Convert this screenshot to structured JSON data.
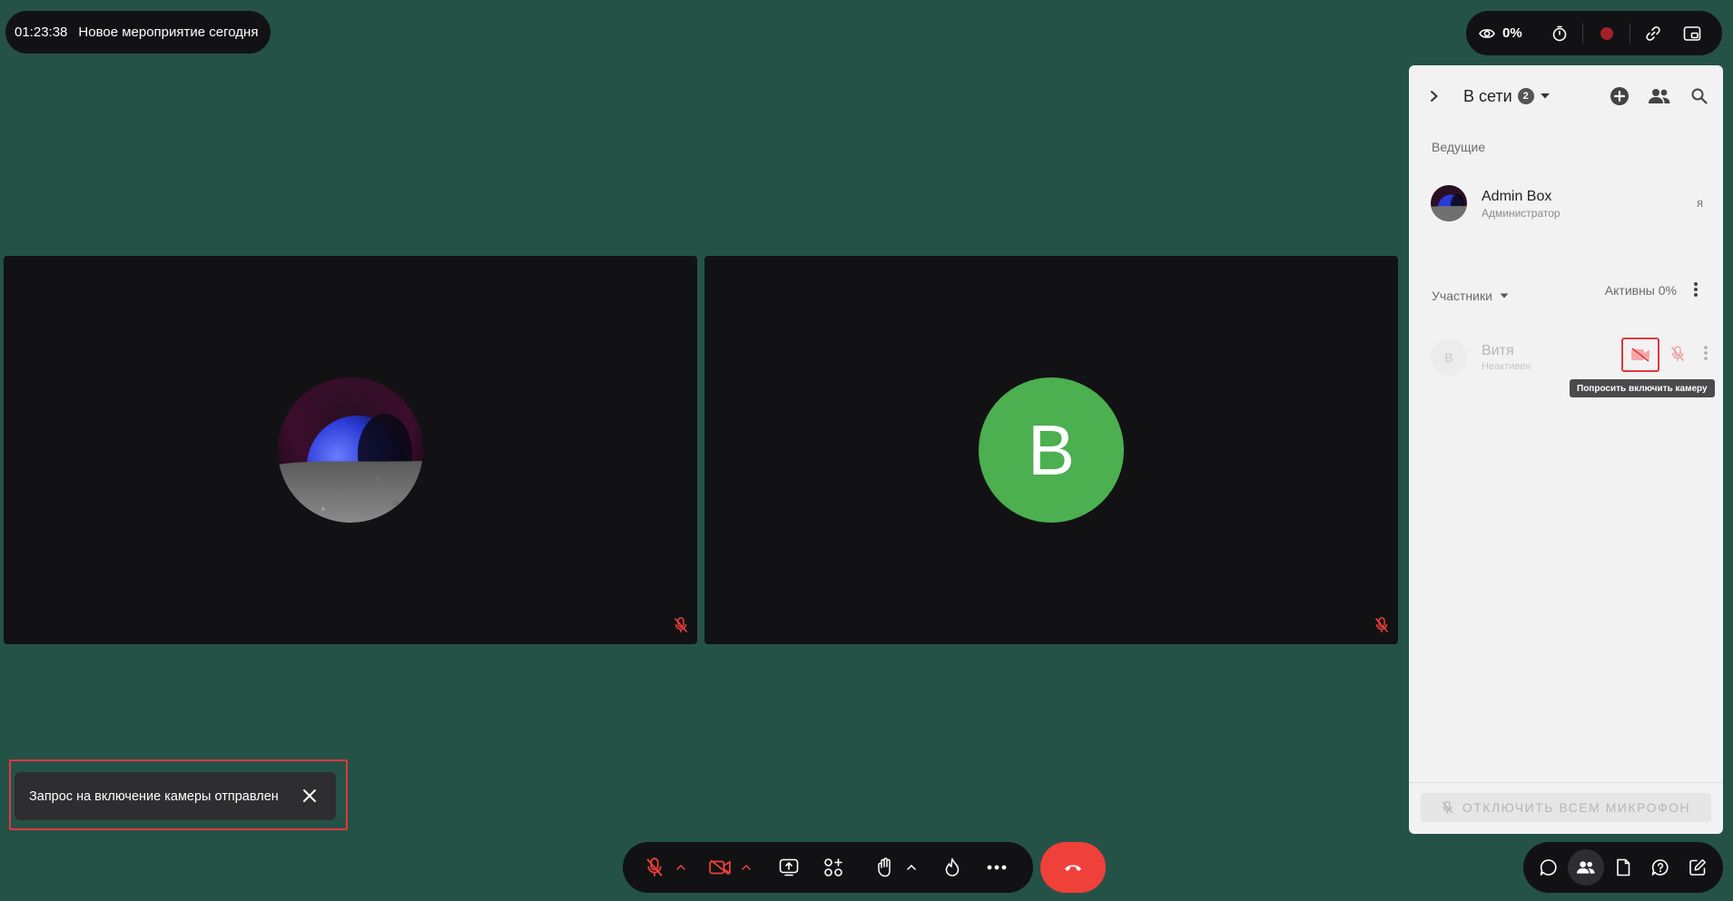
{
  "event": {
    "timer": "01:23:38",
    "title": "Новое мероприятие сегодня"
  },
  "top_toolbar": {
    "views_percent": "0%",
    "icons": [
      "eye-icon",
      "stopwatch-icon",
      "record-icon",
      "link-icon",
      "picture-in-picture-icon"
    ]
  },
  "tiles": [
    {
      "avatar": "planet-avatar",
      "muted": true
    },
    {
      "avatar_letter": "В",
      "avatar_color": "#4caf50",
      "muted": true
    }
  ],
  "panel": {
    "title": "В сети",
    "online_count": "2",
    "hosts_label": "Ведущие",
    "host": {
      "name": "Admin Box",
      "role": "Администратор",
      "me_label": "я"
    },
    "participants_label": "Участники",
    "active_label": "Активны 0%",
    "member": {
      "initial": "В",
      "name": "Витя",
      "status": "Неактивен"
    },
    "tooltip": "Попросить включить камеру",
    "mute_all_label": "ОТКЛЮЧИТЬ ВСЕМ МИКРОФОН"
  },
  "toast": {
    "message": "Запрос на включение камеры отправлен"
  },
  "bottom_toolbar": {
    "icons": [
      "mic-off-icon",
      "camera-off-icon",
      "screen-share-icon",
      "apps-icon",
      "raise-hand-icon",
      "reaction-icon",
      "more-icon"
    ],
    "end_call_icon": "hang-up-icon"
  },
  "bottom_right_toolbar": {
    "icons": [
      "chat-icon",
      "participants-icon",
      "notes-icon",
      "help-icon",
      "edit-icon"
    ],
    "active": "participants-icon"
  },
  "colors": {
    "background": "#255247",
    "accent_red": "#f0403a",
    "highlight_border": "#e2383e",
    "avatar_green": "#4caf50"
  }
}
